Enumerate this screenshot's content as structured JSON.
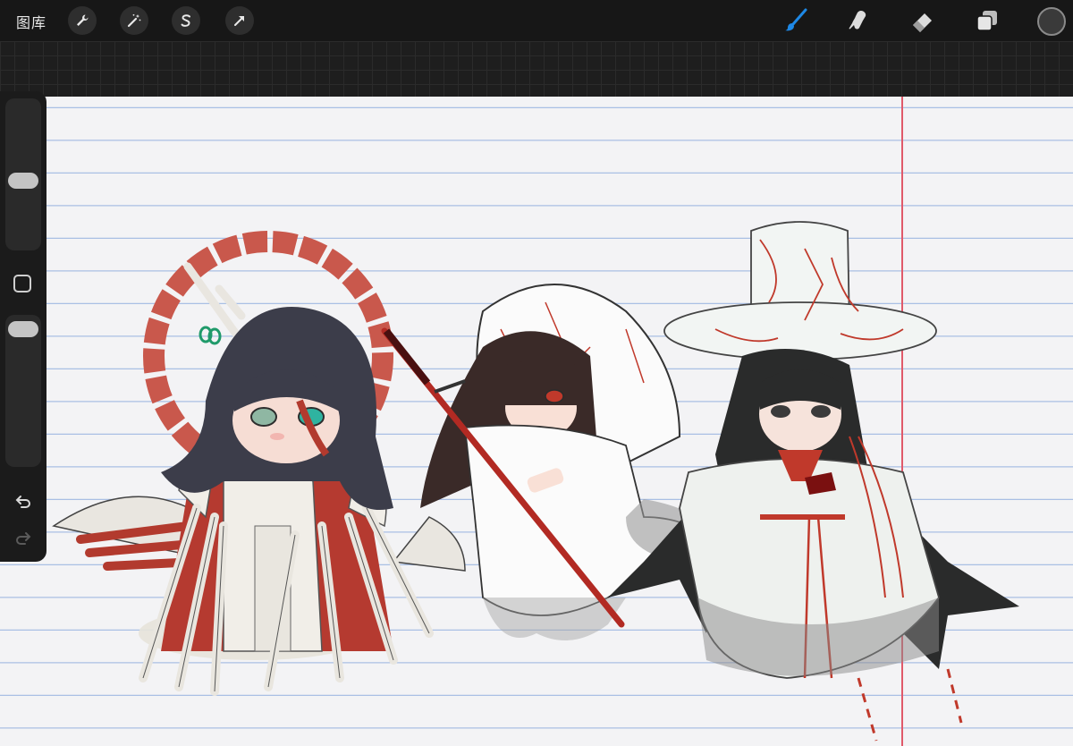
{
  "toolbar": {
    "gallery_label": "图库",
    "left_tools": [
      "wrench-icon",
      "magic-wand-icon",
      "selection-s-icon",
      "transform-arrow-icon"
    ],
    "right_tools": [
      "brush-icon",
      "smudge-icon",
      "eraser-icon",
      "layers-icon"
    ],
    "active_tool": "brush",
    "current_color": "#3a3a3a",
    "accent_color": "#1e88e5"
  },
  "sidebar": {
    "brush_size_fraction": 0.55,
    "opacity_fraction": 0.95,
    "controls": [
      "brush-size-slider",
      "modifier-button",
      "opacity-slider",
      "undo-icon",
      "redo-icon"
    ]
  },
  "canvas": {
    "paper": "lined notebook",
    "line_color": "#a9bfe4",
    "margin_color": "#e05a6a"
  }
}
